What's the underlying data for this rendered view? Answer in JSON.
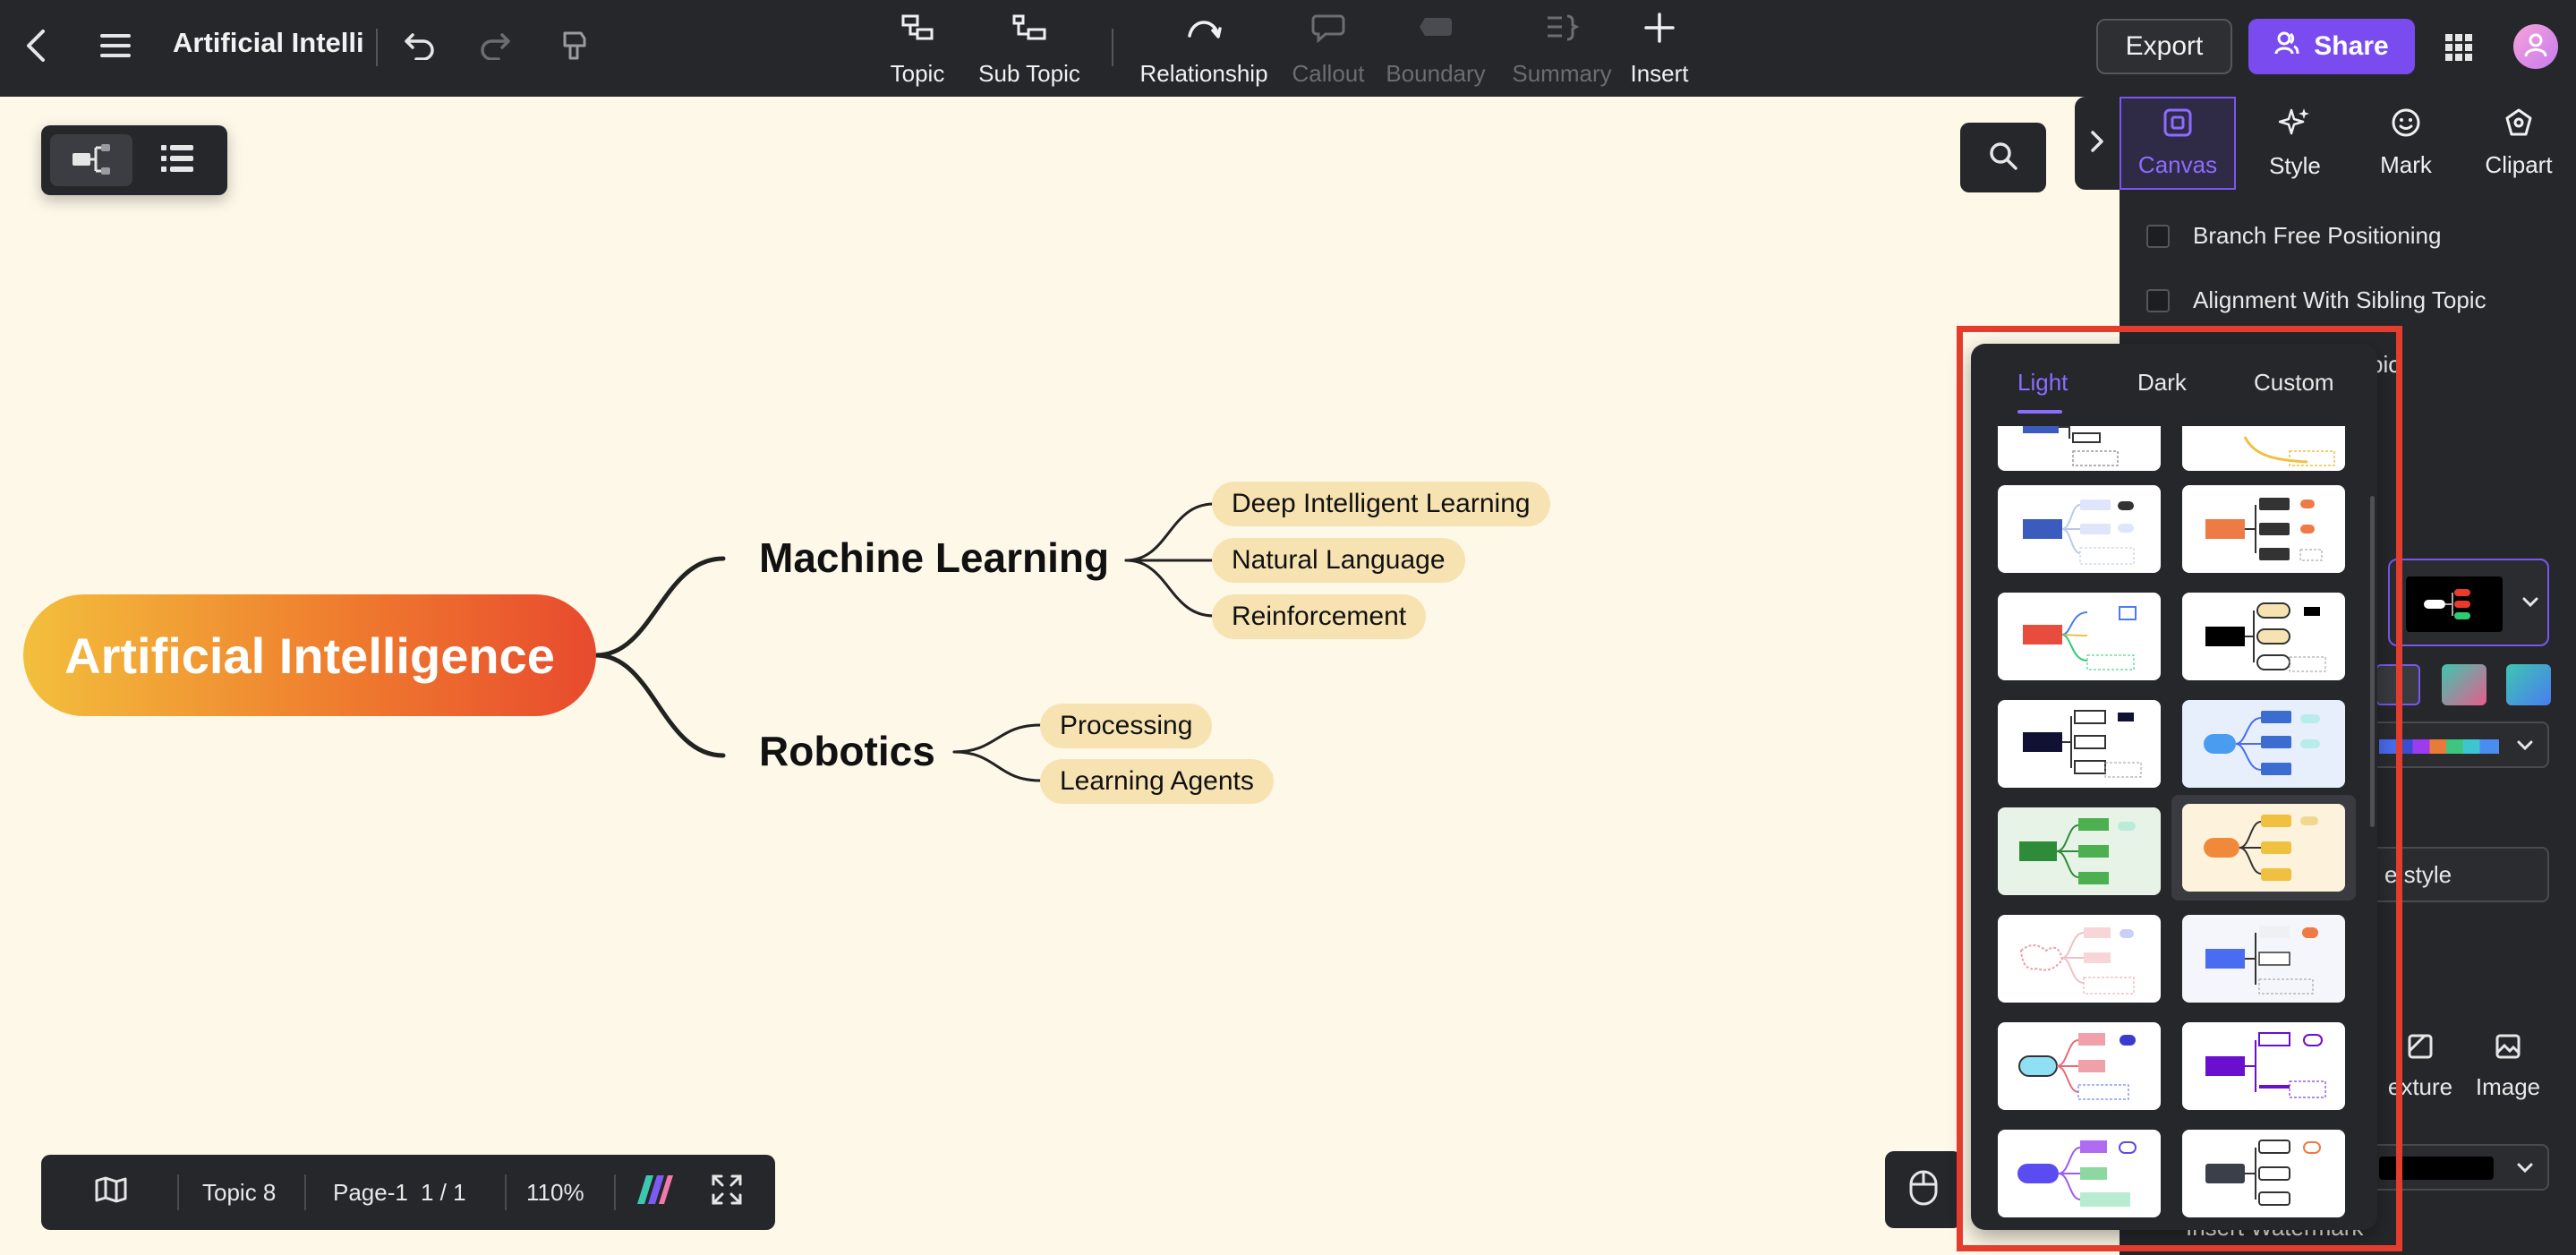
{
  "header": {
    "doc_title": "Artificial Intelli",
    "tools": [
      {
        "label": "Topic",
        "icon": "topic-icon",
        "enabled": true
      },
      {
        "label": "Sub Topic",
        "icon": "subtopic-icon",
        "enabled": true
      },
      {
        "label": "Relationship",
        "icon": "relationship-icon",
        "enabled": true
      },
      {
        "label": "Callout",
        "icon": "callout-icon",
        "enabled": false
      },
      {
        "label": "Boundary",
        "icon": "boundary-icon",
        "enabled": false
      },
      {
        "label": "Summary",
        "icon": "summary-icon",
        "enabled": false
      },
      {
        "label": "Insert",
        "icon": "plus-icon",
        "enabled": true
      }
    ],
    "export_label": "Export",
    "share_label": "Share"
  },
  "mindmap": {
    "root": "Artificial Intelligence",
    "topics": [
      {
        "label": "Machine Learning",
        "children": [
          "Deep Intelligent Learning",
          "Natural Language",
          "Reinforcement"
        ]
      },
      {
        "label": "Robotics",
        "children": [
          "Processing",
          "Learning Agents"
        ]
      }
    ]
  },
  "status_bar": {
    "topic_count": "Topic 8",
    "page_label": "Page-1",
    "page_index": "1 / 1",
    "zoom": "110%"
  },
  "right_panel": {
    "tabs": [
      {
        "label": "Canvas",
        "icon": "canvas-icon",
        "active": true
      },
      {
        "label": "Style",
        "icon": "sparkle-icon",
        "active": false
      },
      {
        "label": "Mark",
        "icon": "smiley-icon",
        "active": false
      },
      {
        "label": "Clipart",
        "icon": "clipart-icon",
        "active": false
      }
    ],
    "options": [
      {
        "label": "Branch Free Positioning",
        "checked": false
      },
      {
        "label": "Alignment With Sibling Topic",
        "checked": false
      }
    ],
    "partial_text": {
      "topic_fragment": "pic",
      "style_button_fragment": "e style",
      "texture_fragment": "exture",
      "image_label": "Image",
      "watermark_fragment": "Insert Watermark"
    }
  },
  "theme_popup": {
    "tabs": [
      "Light",
      "Dark",
      "Custom"
    ],
    "active_tab": "Light"
  },
  "colors": {
    "toolbar_bg": "#26272b",
    "canvas_bg": "#fdf8e8",
    "accent": "#7a4cf0",
    "subtopic_fill": "#f7e3b1",
    "highlight_frame": "#e43d2e"
  }
}
